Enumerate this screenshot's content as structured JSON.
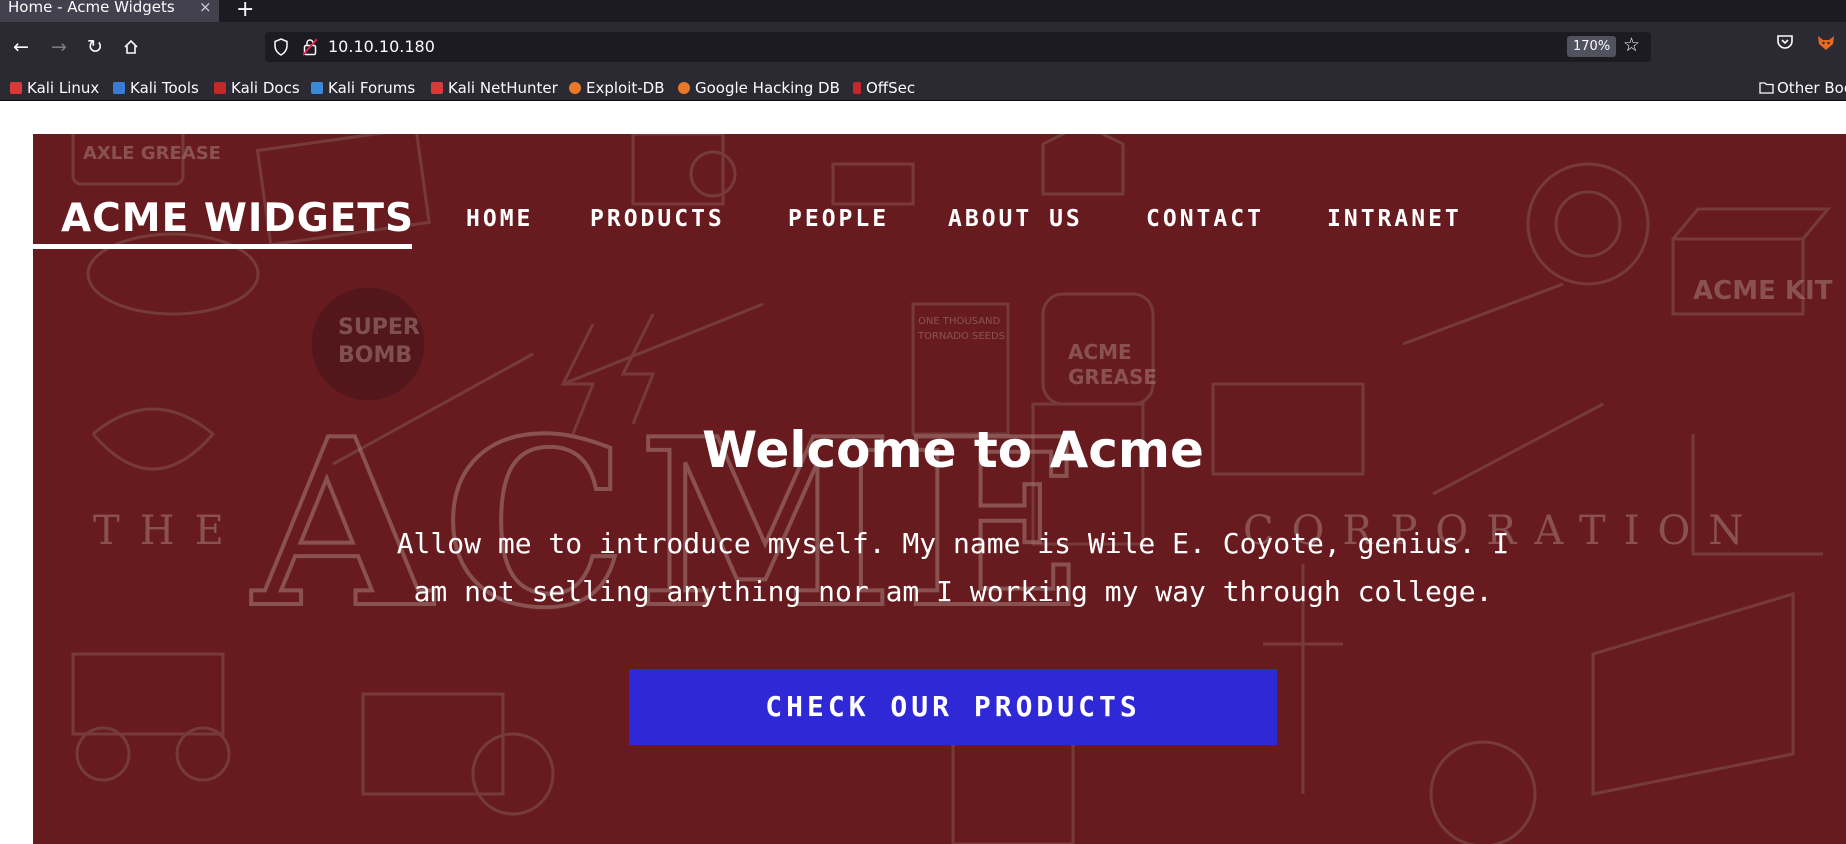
{
  "browser": {
    "tab_title": "Home - Acme Widgets",
    "tab_close": "×",
    "new_tab": "+",
    "url": "10.10.10.180",
    "zoom": "170%",
    "bookmarks": [
      "Kali Linux",
      "Kali Tools",
      "Kali Docs",
      "Kali Forums",
      "Kali NetHunter",
      "Exploit-DB",
      "Google Hacking DB",
      "OffSec"
    ],
    "other_bookmarks": "Other Boo"
  },
  "site": {
    "logo": "ACME WIDGETS",
    "menu": [
      "HOME",
      "PRODUCTS",
      "PEOPLE",
      "ABOUT US",
      "CONTACT",
      "INTRANET"
    ],
    "headline": "Welcome to Acme",
    "intro_line1": "Allow me to introduce myself. My name is Wile E. Coyote, genius. I",
    "intro_line2": "am not selling anything nor am I working my way through college.",
    "cta": "CHECK OUR PRODUCTS",
    "background_words": [
      "THE",
      "ACME",
      "CORPORATION",
      "ACME KIT",
      "SUPER BOMB",
      "ACME GREASE",
      "AXLE GREASE",
      "ONE THOUSAND TORNADO SEEDS"
    ]
  },
  "colors": {
    "hero_bg": "#6b1e22",
    "cta_bg": "#2f28d6",
    "chrome_dark": "#1c1b22",
    "chrome": "#2b2a33"
  }
}
